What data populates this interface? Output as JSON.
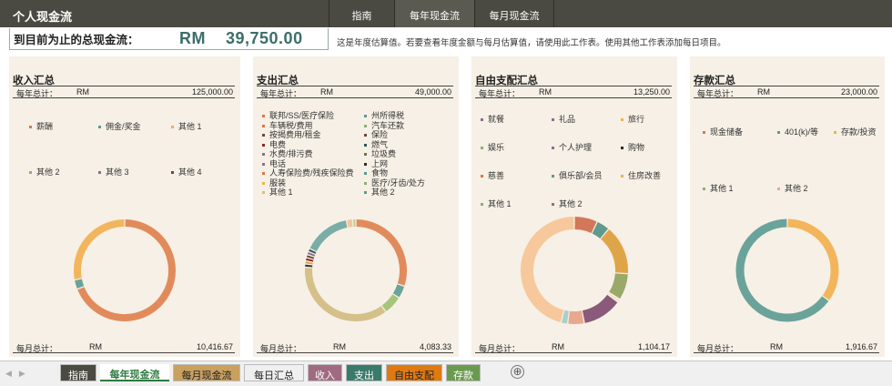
{
  "header": {
    "title": "个人现金流",
    "nav": [
      "指南",
      "每年现金流",
      "每月现金流"
    ]
  },
  "summary": {
    "label": "到目前为止的总现金流：",
    "amount": "RM    39,750.00",
    "note": "这是年度估算值。若要查看年度金额与每月估算值，请使用此工作表。使用其他工作表添加每日项目。"
  },
  "panels": [
    {
      "title": "收入汇总",
      "year_label": "每年总计：",
      "currency": "RM",
      "year_total": "125,000.00",
      "month_label": "每月总计：",
      "month_total": "10,416.67",
      "legend": [
        {
          "label": "薪酬",
          "color": "#d9774a"
        },
        {
          "label": "佣金/奖金",
          "color": "#5a9a90"
        },
        {
          "label": "其他 1",
          "color": "#f0b24a"
        },
        {
          "label": "其他 2",
          "color": "#8cb070"
        },
        {
          "label": "其他 3",
          "color": "#8a6f90"
        },
        {
          "label": "其他 4",
          "color": "#6a4a3a"
        }
      ],
      "donut": [
        {
          "label": "薪酬",
          "value": 0.69,
          "color": "#e18b5c"
        },
        {
          "label": "佣金/奖金",
          "value": 0.03,
          "color": "#6aa39a"
        },
        {
          "label": "其他 1",
          "value": 0.28,
          "color": "#f3b55c"
        }
      ]
    },
    {
      "title": "支出汇总",
      "year_label": "每年总计：",
      "currency": "RM",
      "year_total": "49,000.00",
      "month_label": "每月总计：",
      "month_total": "4,083.33",
      "legend": [
        {
          "label": "联邦/SS/医疗保险",
          "color": "#d9774a"
        },
        {
          "label": "州所得税",
          "color": "#5a9a90"
        },
        {
          "label": "车辆税/费用",
          "color": "#d9774a"
        },
        {
          "label": "汽车还款",
          "color": "#8cb070"
        },
        {
          "label": "按揭费用/租金",
          "color": "#6a4a3a"
        },
        {
          "label": "保险",
          "color": "#6a4a3a"
        },
        {
          "label": "电费",
          "color": "#8a2a2a"
        },
        {
          "label": "燃气",
          "color": "#2a5a50"
        },
        {
          "label": "水费/排污费",
          "color": "#8a6f90"
        },
        {
          "label": "垃圾费",
          "color": "#6a7a3a"
        },
        {
          "label": "电话",
          "color": "#8a6f90"
        },
        {
          "label": "上网",
          "color": "#2a2a2a"
        },
        {
          "label": "人寿保险费/残疾保险费",
          "color": "#d9774a"
        },
        {
          "label": "食物",
          "color": "#5a9a90"
        },
        {
          "label": "服装",
          "color": "#f0b24a"
        },
        {
          "label": "医疗/牙齿/处方",
          "color": "#8cb070"
        },
        {
          "label": "其他 1",
          "color": "#d9c080"
        },
        {
          "label": "其他 2",
          "color": "#5a9a90"
        }
      ],
      "donut": [
        {
          "label": "联邦/SS/医疗保险",
          "value": 0.3,
          "color": "#e18b5c"
        },
        {
          "label": "州所得税",
          "value": 0.04,
          "color": "#6aa39a"
        },
        {
          "label": "汽车还款",
          "value": 0.06,
          "color": "#a8c47a"
        },
        {
          "label": "其他 1",
          "value": 0.36,
          "color": "#d6c08a"
        },
        {
          "label": "上网",
          "value": 0.01,
          "color": "#3a3a3a"
        },
        {
          "label": "服装",
          "value": 0.01,
          "color": "#e8a050"
        },
        {
          "label": "电费",
          "value": 0.01,
          "color": "#8a2a2a"
        },
        {
          "label": "按揭费用/租金",
          "value": 0.01,
          "color": "#6a4a3a"
        },
        {
          "label": "电话",
          "value": 0.01,
          "color": "#8a6f90"
        },
        {
          "label": "燃气",
          "value": 0.01,
          "color": "#2a5a50"
        },
        {
          "label": "其他 2",
          "value": 0.15,
          "color": "#7aada5"
        },
        {
          "label": "人寿保险费/残疾保险费",
          "value": 0.02,
          "color": "#f4c49c"
        },
        {
          "label": "医疗/牙齿/处方",
          "value": 0.01,
          "color": "#b8d090"
        }
      ]
    },
    {
      "title": "自由支配汇总",
      "year_label": "每年总计：",
      "currency": "RM",
      "year_total": "13,250.00",
      "month_label": "每月总计：",
      "month_total": "1,104.17",
      "legend": [
        {
          "label": "就餐",
          "color": "#8a6f90"
        },
        {
          "label": "礼品",
          "color": "#8a6f90"
        },
        {
          "label": "旅行",
          "color": "#f0b24a"
        },
        {
          "label": "娱乐",
          "color": "#8cb070"
        },
        {
          "label": "个人护理",
          "color": "#8a6f90"
        },
        {
          "label": "购物",
          "color": "#2a2a2a"
        },
        {
          "label": "慈善",
          "color": "#d9774a"
        },
        {
          "label": "俱乐部/会员",
          "color": "#5a9a90"
        },
        {
          "label": "住房改善",
          "color": "#f0b24a"
        },
        {
          "label": "其他 1",
          "color": "#8cb070"
        },
        {
          "label": "其他 2",
          "color": "#8a6f90"
        }
      ],
      "donut": [
        {
          "label": "就餐",
          "value": 0.07,
          "color": "#d2775a"
        },
        {
          "label": "礼品",
          "value": 0.04,
          "color": "#5f9a8d"
        },
        {
          "label": "旅行",
          "value": 0.15,
          "color": "#e0a448"
        },
        {
          "label": "娱乐",
          "value": 0.08,
          "color": "#9aa86a"
        },
        {
          "label": "个人护理",
          "value": 0.01,
          "color": "#f0e4c8"
        },
        {
          "label": "购物",
          "value": 0.12,
          "color": "#8a5a7a"
        },
        {
          "label": "慈善",
          "value": 0.05,
          "color": "#e8a890"
        },
        {
          "label": "俱乐部/会员",
          "value": 0.02,
          "color": "#a8d0c8"
        },
        {
          "label": "住房改善",
          "value": 0.46,
          "color": "#f6c89c"
        }
      ]
    },
    {
      "title": "存款汇总",
      "year_label": "每年总计：",
      "currency": "RM",
      "year_total": "23,000.00",
      "month_label": "每月总计：",
      "month_total": "1,916.67",
      "legend": [
        {
          "label": "现金储备",
          "color": "#d9774a"
        },
        {
          "label": "401(k)/等",
          "color": "#5a9a90"
        },
        {
          "label": "存款/投资",
          "color": "#f0b24a"
        },
        {
          "label": "其他 1",
          "color": "#8cb070"
        },
        {
          "label": "其他 2",
          "color": "#e8a890"
        }
      ],
      "donut": [
        {
          "label": "存款/投资",
          "value": 0.35,
          "color": "#f3b55c"
        },
        {
          "label": "401(k)/等",
          "value": 0.65,
          "color": "#6aa39a"
        }
      ]
    }
  ],
  "sheet_tabs": [
    {
      "label": "指南",
      "bg": "#4a4a42",
      "fg": "#ffffff",
      "active": false
    },
    {
      "label": "每年现金流",
      "bg": "#ffffff",
      "fg": "#2e7a40",
      "active": true
    },
    {
      "label": "每月现金流",
      "bg": "#c8a060",
      "fg": "#222222",
      "active": false
    },
    {
      "label": "每日汇总",
      "bg": "#f0f0f0",
      "fg": "#222222",
      "active": false
    },
    {
      "label": "收入",
      "bg": "#a06a80",
      "fg": "#ffffff",
      "active": false
    },
    {
      "label": "支出",
      "bg": "#3a7a6a",
      "fg": "#ffffff",
      "active": false
    },
    {
      "label": "自由支配",
      "bg": "#e07a10",
      "fg": "#222222",
      "active": false
    },
    {
      "label": "存款",
      "bg": "#6a9a50",
      "fg": "#ffffff",
      "active": false
    }
  ],
  "add_sheet": "⊕"
}
